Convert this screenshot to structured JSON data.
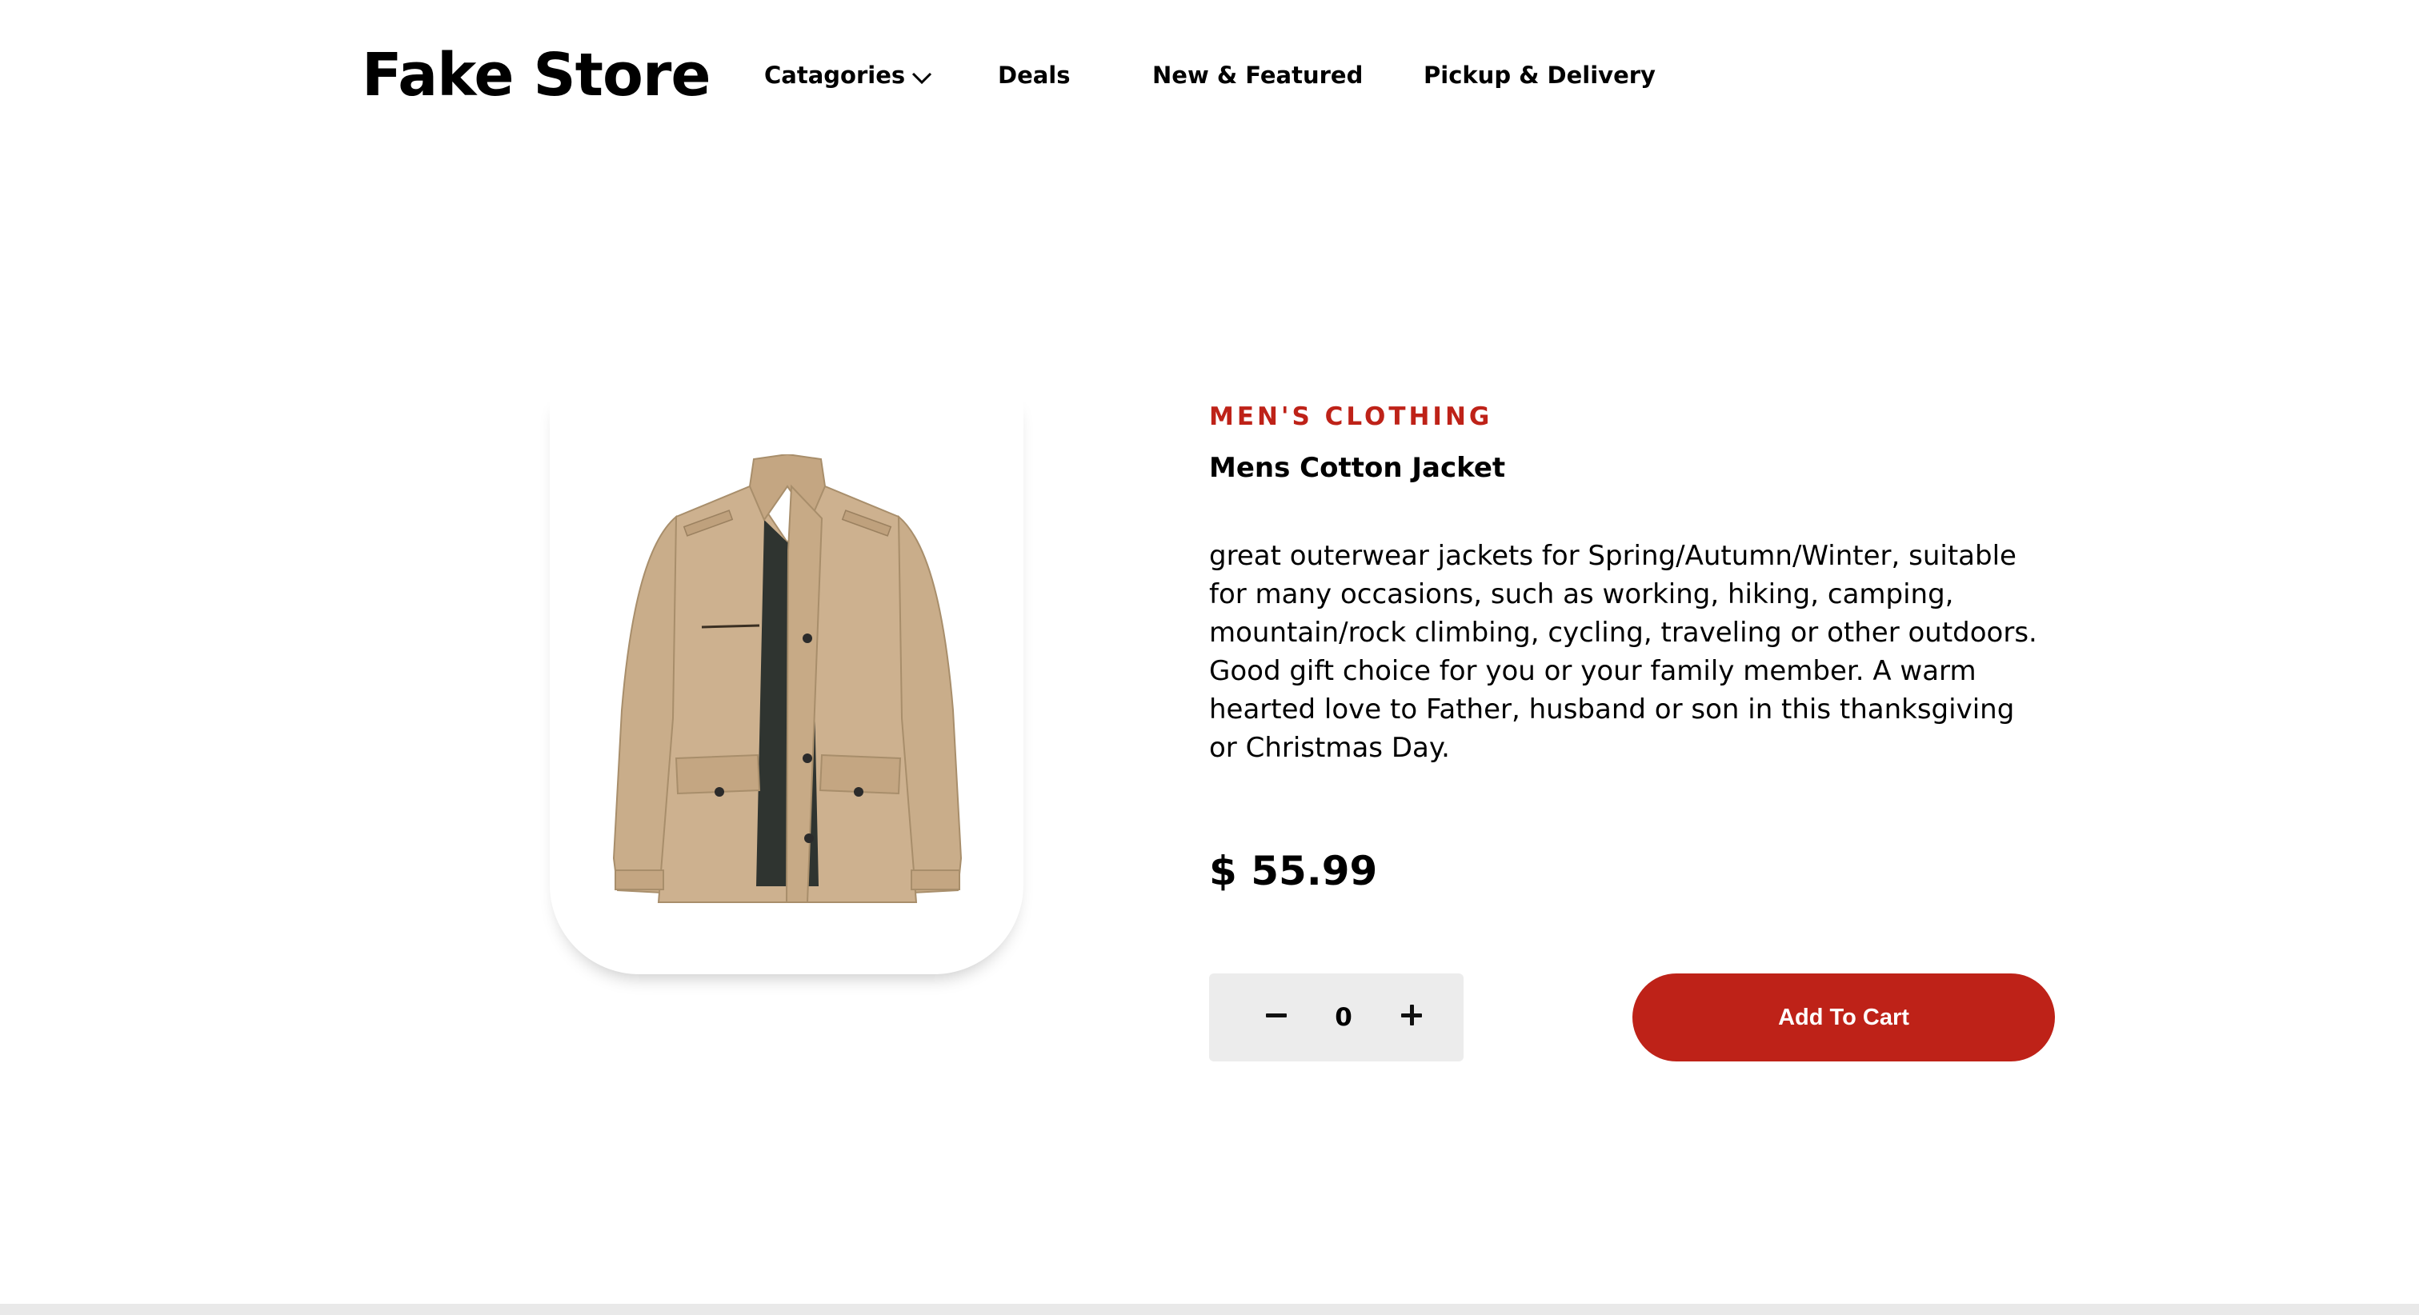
{
  "header": {
    "brand": "Fake Store",
    "nav": {
      "categories": "Catagories",
      "deals": "Deals",
      "new_featured": "New & Featured",
      "pickup_delivery": "Pickup & Delivery"
    }
  },
  "product": {
    "category": "MEN'S CLOTHING",
    "title": "Mens Cotton Jacket",
    "description": "great outerwear jackets for Spring/Autumn/Winter, suitable for many occasions, such as working, hiking, camping, mountain/rock climbing, cycling, traveling or other outdoors. Good gift choice for you or your family member. A warm hearted love to Father, husband or son in this thanksgiving or Christmas Day.",
    "price": "$ 55.99",
    "image_icon": "jacket-image"
  },
  "quantity": {
    "value": "0",
    "decrement_icon": "minus-icon",
    "increment_icon": "plus-icon"
  },
  "cart": {
    "add_label": "Add To Cart"
  },
  "colors": {
    "accent": "#be2218",
    "qty_bg": "#ececec",
    "jacket": "#cdb18f"
  }
}
